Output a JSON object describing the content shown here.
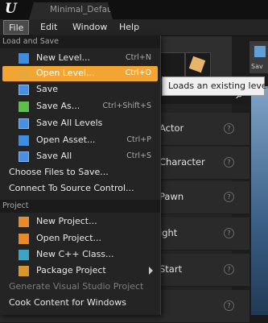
{
  "window": {
    "title": "Minimal_Default"
  },
  "menubar": [
    {
      "label": "File",
      "active": true
    },
    {
      "label": "Edit"
    },
    {
      "label": "Window"
    },
    {
      "label": "Help"
    }
  ],
  "background": {
    "list_labels": [
      "Actor",
      "Character",
      "Pawn",
      "ight",
      "Start"
    ],
    "side_tab_label": "Sav"
  },
  "tooltip": "Loads an existing level",
  "file_menu": {
    "sections": [
      {
        "header": "Load and Save",
        "items": [
          {
            "label": "New Level...",
            "shortcut": "Ctrl+N",
            "icon": "new-level-icon"
          },
          {
            "label": "Open Level...",
            "shortcut": "Ctrl+O",
            "icon": "open-level-icon",
            "highlighted": true
          },
          {
            "label": "Save",
            "shortcut": "",
            "icon": "save-icon"
          },
          {
            "label": "Save As...",
            "shortcut": "Ctrl+Shift+S",
            "icon": "save-as-icon"
          },
          {
            "label": "Save All Levels",
            "shortcut": "",
            "icon": "save-all-levels-icon"
          },
          {
            "label": "Open Asset...",
            "shortcut": "Ctrl+P",
            "icon": "open-asset-icon"
          },
          {
            "label": "Save All",
            "shortcut": "Ctrl+S",
            "icon": "save-all-icon"
          },
          {
            "label": "Choose Files to Save...",
            "shortcut": ""
          },
          {
            "label": "Connect To Source Control...",
            "shortcut": ""
          }
        ]
      },
      {
        "header": "Project",
        "items": [
          {
            "label": "New Project...",
            "icon": "new-project-icon"
          },
          {
            "label": "Open Project...",
            "icon": "open-project-icon"
          },
          {
            "label": "New C++ Class...",
            "icon": "new-cpp-class-icon"
          },
          {
            "label": "Package Project",
            "icon": "package-project-icon",
            "submenu": true
          },
          {
            "label": "Generate Visual Studio Project",
            "disabled": true
          },
          {
            "label": "Cook Content for Windows"
          }
        ]
      }
    ]
  }
}
